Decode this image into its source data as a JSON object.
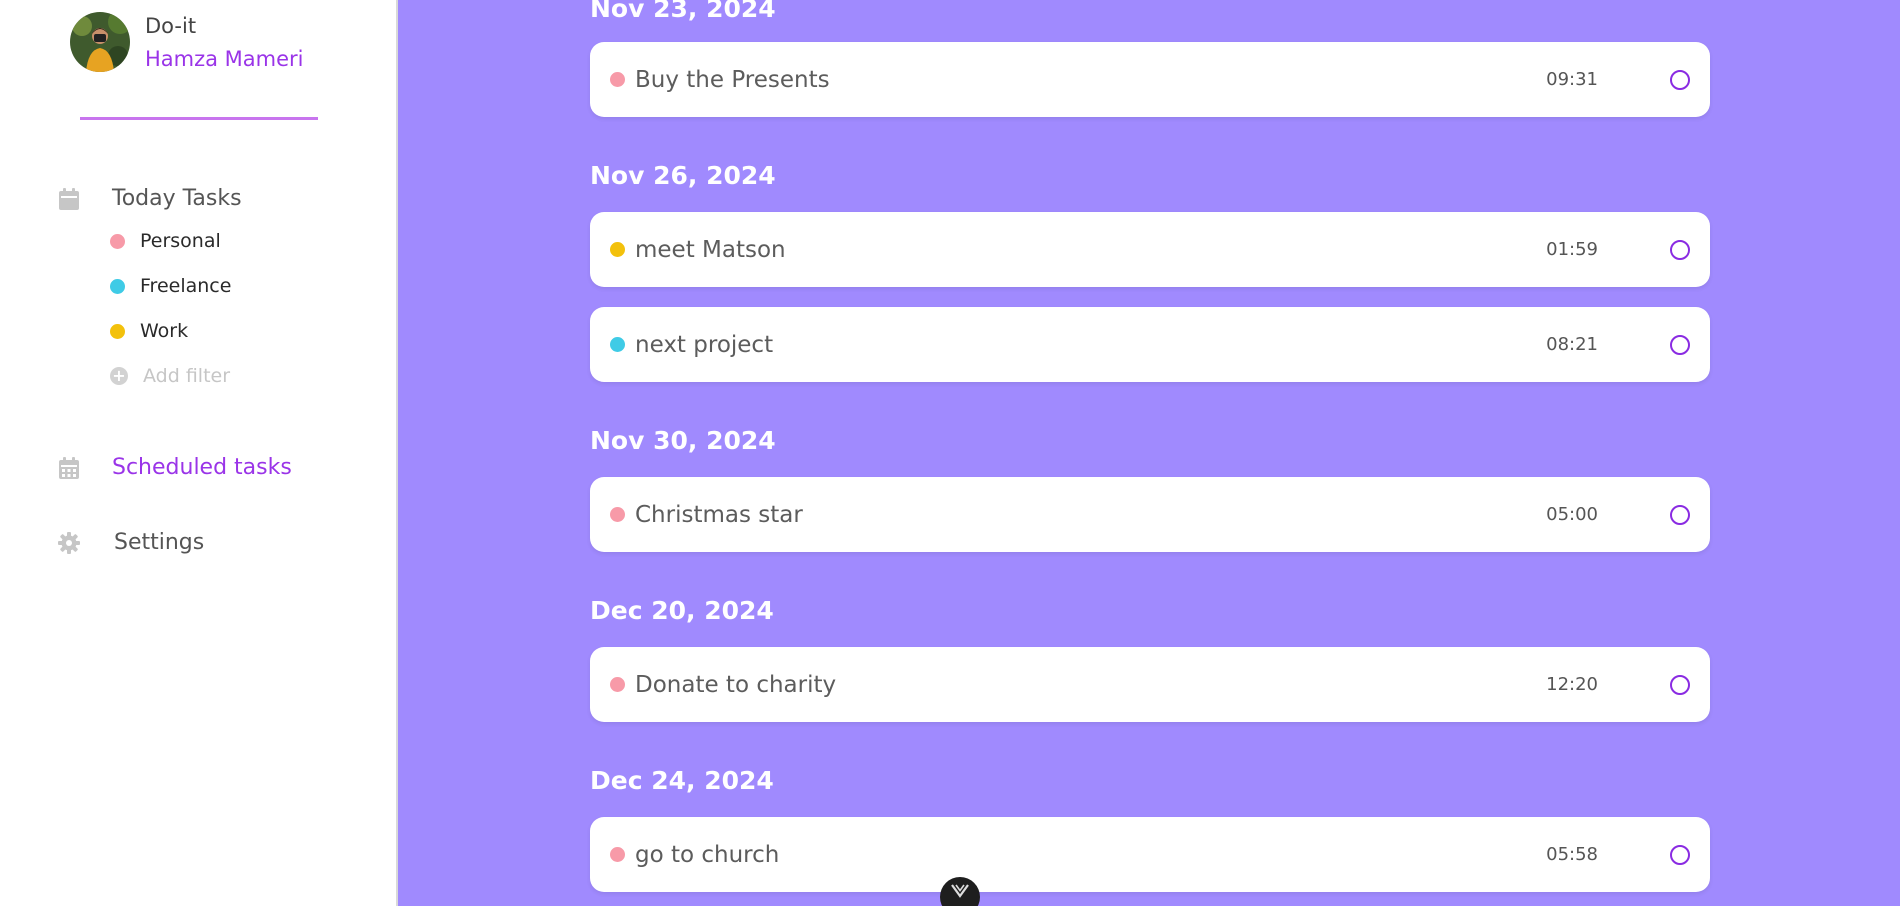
{
  "profile": {
    "app_name": "Do-it",
    "user_name": "Hamza Mameri"
  },
  "nav": {
    "today": "Today Tasks",
    "scheduled": "Scheduled tasks",
    "settings": "Settings"
  },
  "filters": {
    "personal": "Personal",
    "freelance": "Freelance",
    "work": "Work",
    "add": "Add filter"
  },
  "colors": {
    "personal": "#f79aa8",
    "freelance": "#3fcbe6",
    "work": "#f3c10c",
    "accent": "#9a34e8",
    "background": "#a08afe"
  },
  "groups": [
    {
      "date": "Nov 23, 2024",
      "tasks": [
        {
          "title": "Buy the Presents",
          "time": "09:31",
          "category": "personal"
        }
      ]
    },
    {
      "date": "Nov 26, 2024",
      "tasks": [
        {
          "title": "meet Matson",
          "time": "01:59",
          "category": "work"
        },
        {
          "title": "next project",
          "time": "08:21",
          "category": "freelance"
        }
      ]
    },
    {
      "date": "Nov 30, 2024",
      "tasks": [
        {
          "title": "Christmas star",
          "time": "05:00",
          "category": "personal"
        }
      ]
    },
    {
      "date": "Dec 20, 2024",
      "tasks": [
        {
          "title": "Donate to charity",
          "time": "12:20",
          "category": "personal"
        }
      ]
    },
    {
      "date": "Dec 24, 2024",
      "tasks": [
        {
          "title": "go to church",
          "time": "05:58",
          "category": "personal"
        }
      ]
    }
  ],
  "icons": {
    "today": "calendar-icon",
    "scheduled": "calendar-grid-icon",
    "settings": "gear-icon",
    "add_filter": "plus-circle-icon",
    "toggle": "chevron-down-icon"
  }
}
